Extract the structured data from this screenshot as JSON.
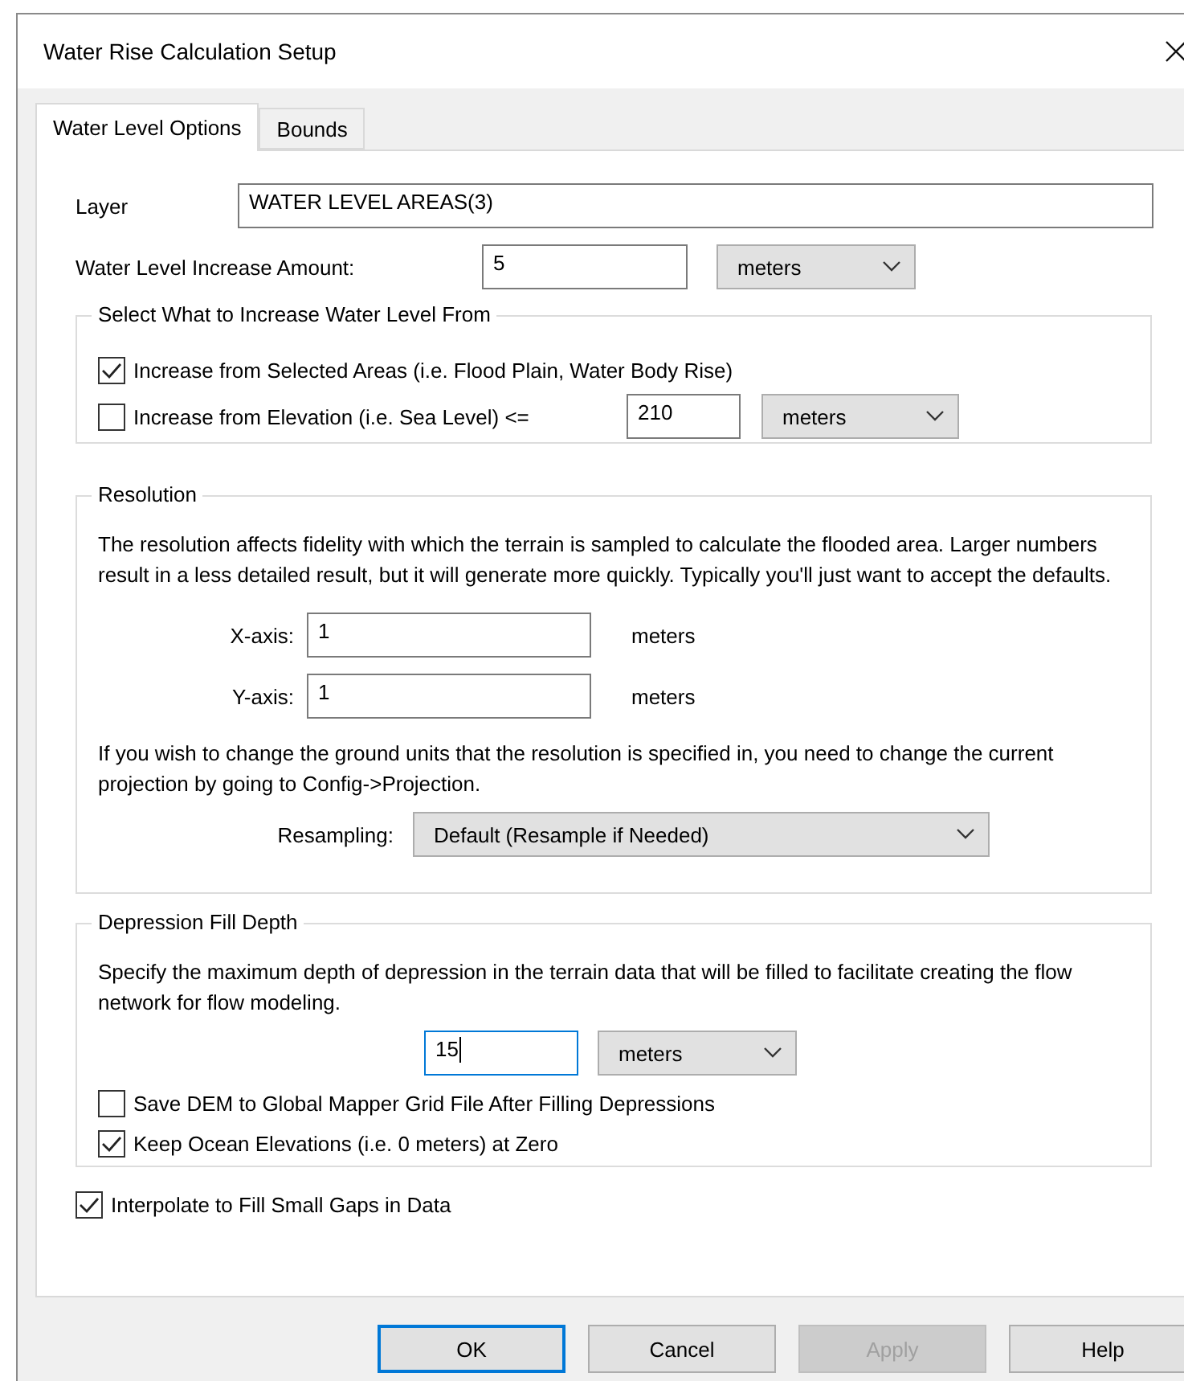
{
  "window": {
    "title": "Water Rise Calculation Setup"
  },
  "tabs": [
    {
      "label": "Water Level Options",
      "selected": true
    },
    {
      "label": "Bounds",
      "selected": false
    }
  ],
  "layer": {
    "label": "Layer",
    "value": "WATER LEVEL AREAS(3)"
  },
  "increase": {
    "label": "Water Level Increase Amount:",
    "value": "5",
    "unit": "meters"
  },
  "source_group": {
    "title": "Select What to Increase Water Level From",
    "options": [
      {
        "kind": "plain",
        "label": "Increase from Selected Areas  (i.e. Flood Plain, Water Body Rise)",
        "checked": true
      },
      {
        "kind": "valued",
        "label": "Increase from Elevation (i.e. Sea Level) <=",
        "checked": false,
        "value": "210",
        "unit": "meters"
      }
    ]
  },
  "resolution": {
    "title": "Resolution",
    "description": "The resolution affects fidelity with which the terrain is sampled to calculate the flooded area. Larger numbers result in a less detailed result, but it will generate more quickly. Typically you'll just want to accept the defaults.",
    "axes": [
      {
        "label": "X-axis:",
        "value": "1",
        "unit": "meters"
      },
      {
        "label": "Y-axis:",
        "value": "1",
        "unit": "meters"
      }
    ],
    "note": "If you wish to change the ground units that the resolution is specified in, you need to change the current projection by going to Config->Projection.",
    "resampling": {
      "label": "Resampling:",
      "value": "Default (Resample if Needed)"
    }
  },
  "depression": {
    "title": "Depression Fill Depth",
    "description": "Specify the maximum depth of depression in the terrain data that will be filled to facilitate creating the flow network for flow modeling.",
    "value": "15",
    "focused": true,
    "unit": "meters",
    "options": [
      {
        "label": "Save DEM to Global Mapper Grid File After Filling Depressions",
        "checked": false
      },
      {
        "label": "Keep Ocean Elevations (i.e. 0 meters) at Zero",
        "checked": true
      }
    ]
  },
  "interpolate": {
    "label": "Interpolate to Fill Small Gaps in Data",
    "checked": true
  },
  "buttons": [
    {
      "label": "OK",
      "default": true,
      "disabled": false
    },
    {
      "label": "Cancel",
      "default": false,
      "disabled": false
    },
    {
      "label": "Apply",
      "default": false,
      "disabled": true
    },
    {
      "label": "Help",
      "default": false,
      "disabled": false
    }
  ]
}
